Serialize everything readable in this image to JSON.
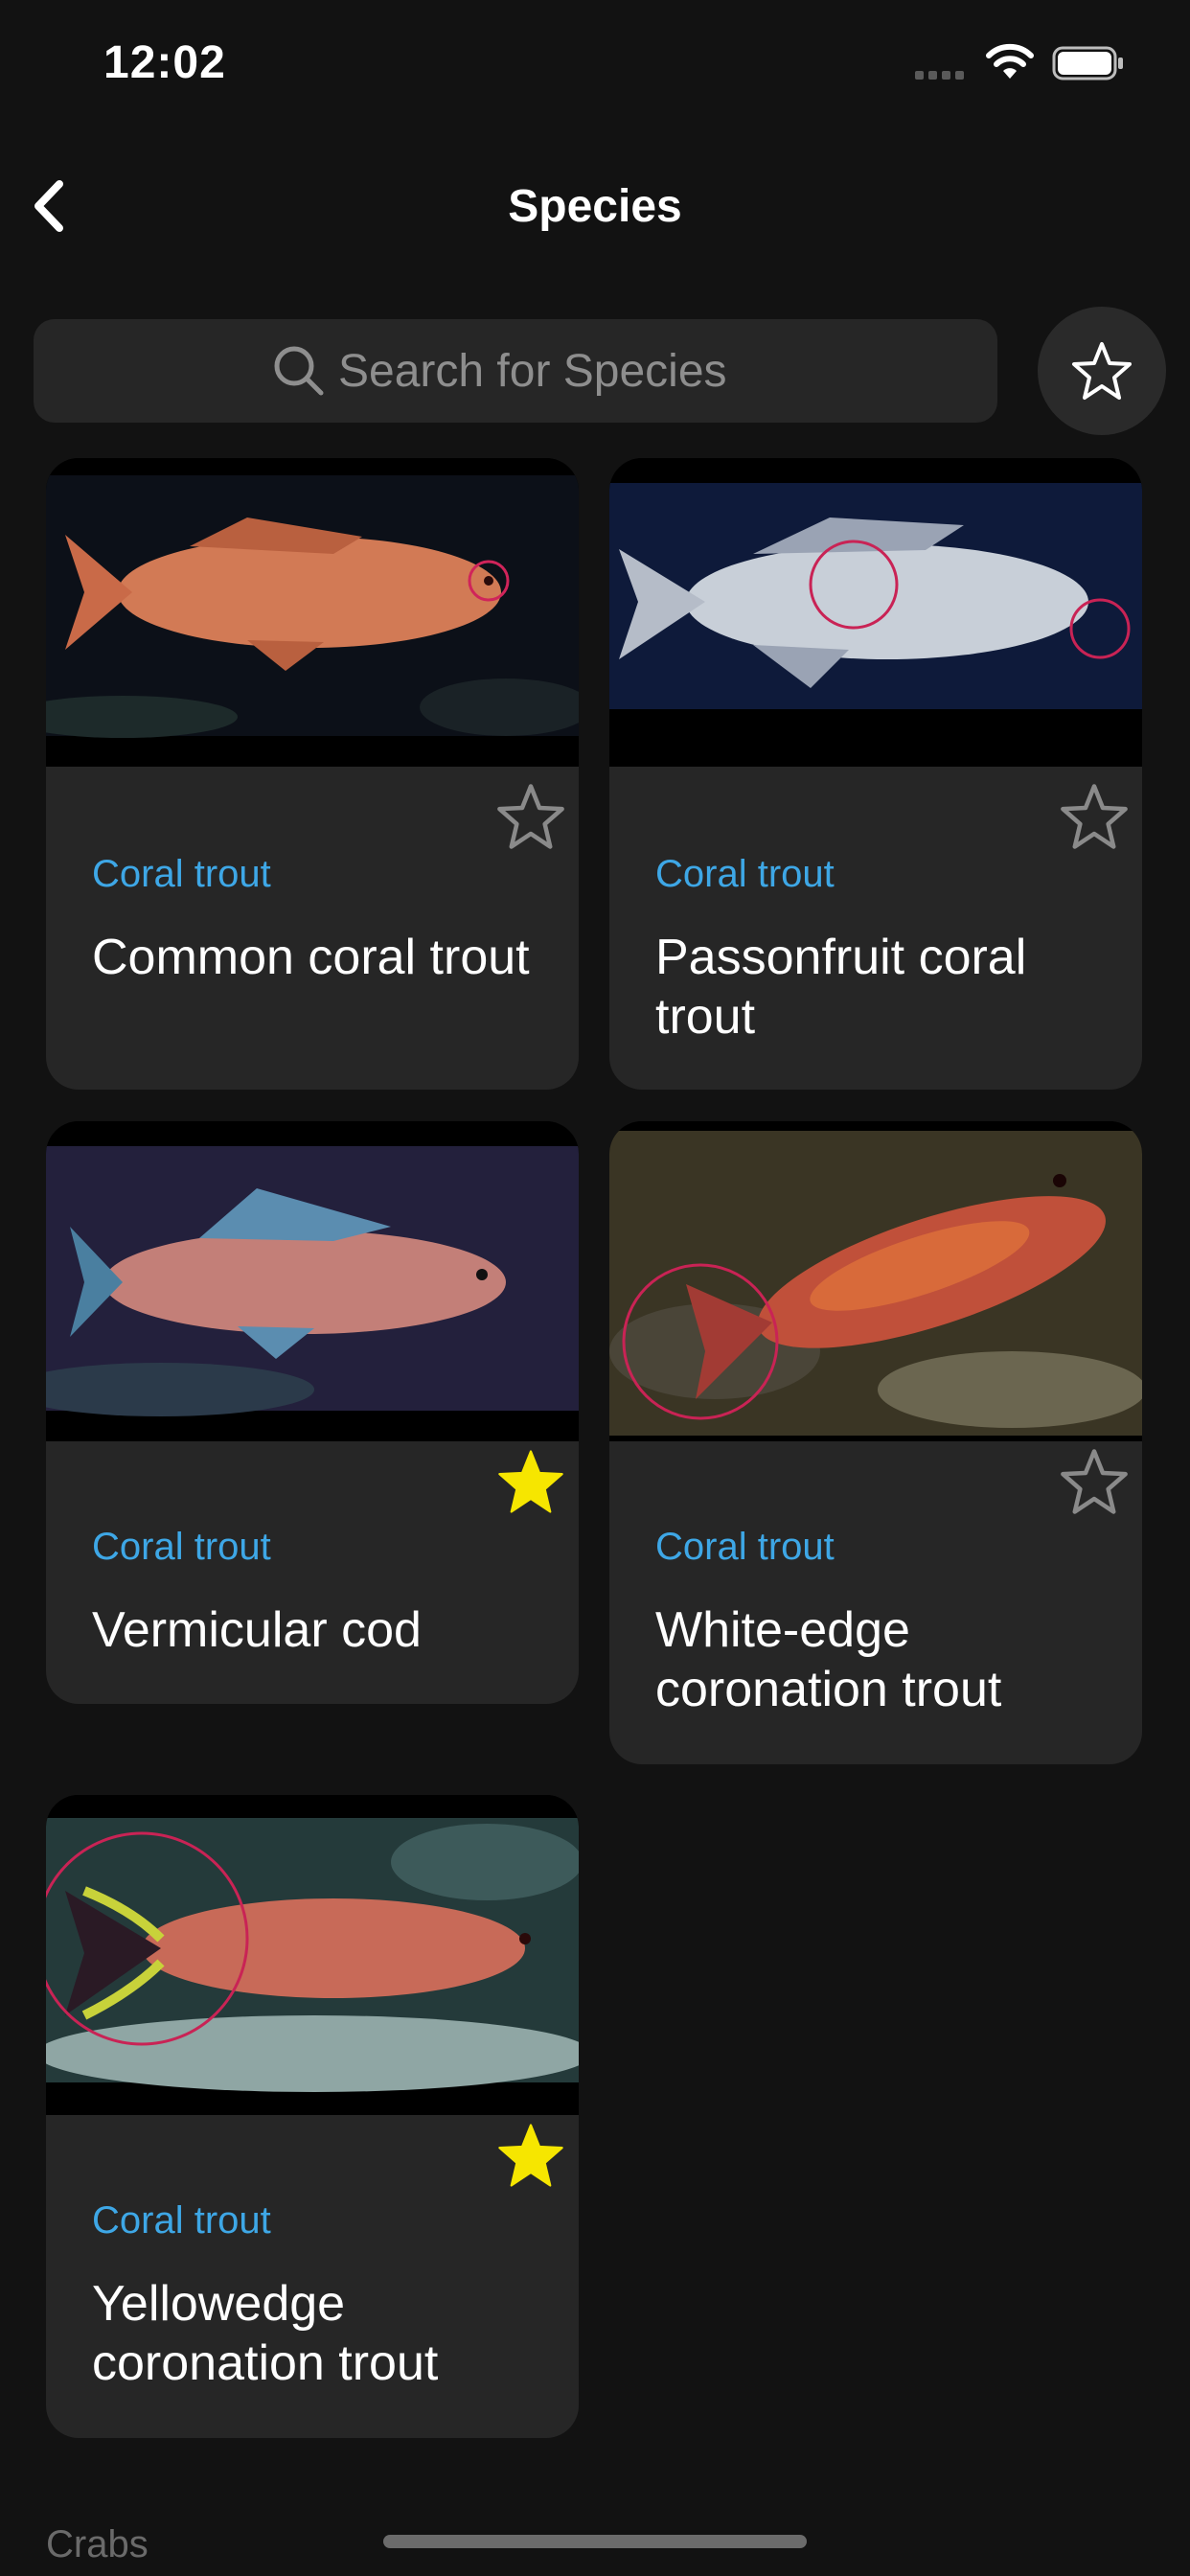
{
  "status_bar": {
    "time": "12:02"
  },
  "nav": {
    "title": "Species",
    "back_icon": "chevron-left-icon"
  },
  "search": {
    "placeholder": "Search for Species",
    "icon": "search-icon"
  },
  "favorites_filter": {
    "icon": "star-outline-icon"
  },
  "colors": {
    "background": "#121212",
    "card": "#262626",
    "accent_category": "#3ea7e6",
    "favorite_star": "#f6e600",
    "unfavorite_star": "#8a8a8a"
  },
  "species": [
    {
      "category": "Coral trout",
      "name": "Common coral trout",
      "favorite": false,
      "icon": "star-outline-icon"
    },
    {
      "category": "Coral trout",
      "name": "Passonfruit coral trout",
      "favorite": false,
      "icon": "star-outline-icon"
    },
    {
      "category": "Coral trout",
      "name": "Vermicular cod",
      "favorite": true,
      "icon": "star-filled-icon"
    },
    {
      "category": "Coral trout",
      "name": "White-edge coronation trout",
      "favorite": false,
      "icon": "star-outline-icon"
    },
    {
      "category": "Coral trout",
      "name": "Yellowedge coronation trout",
      "favorite": true,
      "icon": "star-filled-icon"
    }
  ],
  "next_section": {
    "label": "Crabs"
  }
}
